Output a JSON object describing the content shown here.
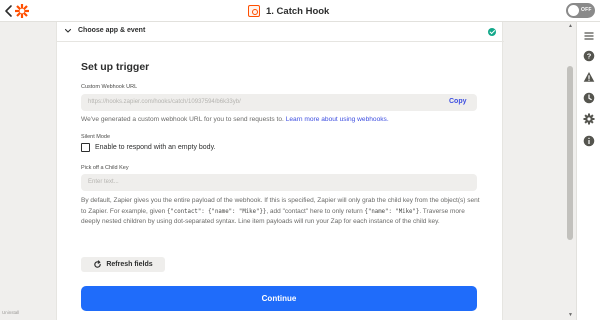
{
  "app": {
    "title": "1. Catch Hook",
    "back_icon": "chevron-left-icon",
    "logo_icon": "zapier-logo-icon",
    "step_icon": "catch-hook-icon",
    "toggle_label": "OFF",
    "brand_color": "#ff4f00"
  },
  "section": {
    "title": "Choose app & event",
    "status_icon": "check-circle-icon",
    "status_color": "#13a88a"
  },
  "trigger": {
    "heading": "Set up trigger",
    "webhook_label": "Custom Webhook URL",
    "webhook_value": "https://hooks.zapier.com/hooks/catch/10937594/b6k33yb/",
    "copy_label": "Copy",
    "webhook_help_prefix": "We've generated a custom webhook URL for you to send requests to. ",
    "webhook_help_link": "Learn more about using webhooks.",
    "silent_label": "Silent Mode",
    "silent_checkbox_label": "Enable to respond with an empty body.",
    "silent_checked": false,
    "child_key_label": "Pick off a Child Key",
    "child_key_placeholder": "Enter text...",
    "desc_1": "By default, Zapier gives you the entire payload of the webhook. If this is specified, Zapier will only grab the child key from the object(s) sent to Zapier. For example, given ",
    "code_1": "{\"contact\": {\"name\": \"Mike\"}}",
    "desc_2": ", add \"contact\" here to only return ",
    "code_2": "{\"name\": \"Mike\"}",
    "desc_3": ". Traverse more deeply nested children by using dot-separated syntax. Line item payloads will run your Zap for each instance of the child key.",
    "refresh_label": "Refresh fields",
    "continue_label": "Continue",
    "primary_color": "#1f6cfa"
  },
  "rail": {
    "icons": [
      "list-icon",
      "help-icon",
      "alert-icon",
      "clock-icon",
      "gear-icon",
      "info-icon"
    ]
  },
  "footer": {
    "text": "Uninstall"
  }
}
